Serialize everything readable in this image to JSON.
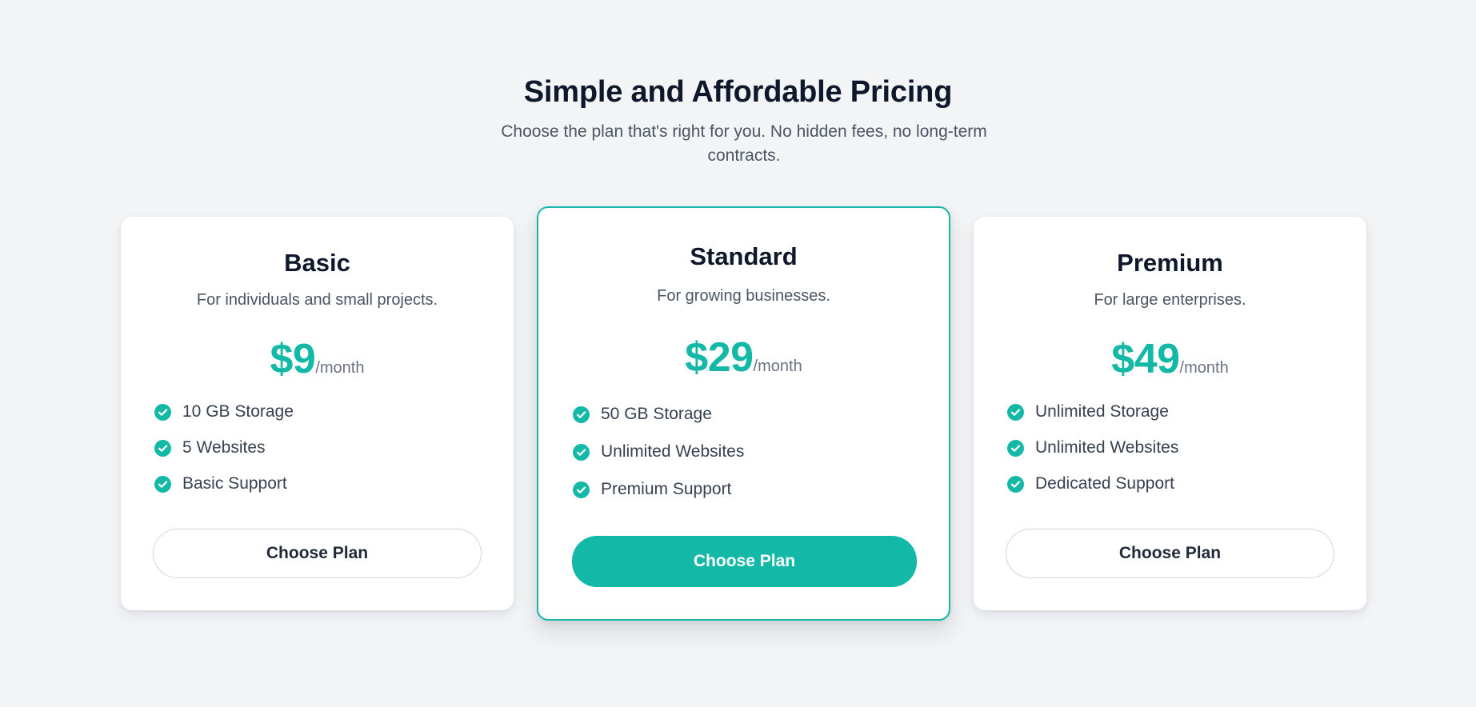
{
  "header": {
    "title": "Simple and Affordable Pricing",
    "subtitle": "Choose the plan that's right for you. No hidden fees, no long-term contracts."
  },
  "plans": [
    {
      "name": "Basic",
      "description": "For individuals and small projects.",
      "price": "$9",
      "period": "/month",
      "features": [
        "10 GB Storage",
        "5 Websites",
        "Basic Support"
      ],
      "button_label": "Choose Plan",
      "featured": false
    },
    {
      "name": "Standard",
      "description": "For growing businesses.",
      "price": "$29",
      "period": "/month",
      "features": [
        "50 GB Storage",
        "Unlimited Websites",
        "Premium Support"
      ],
      "button_label": "Choose Plan",
      "featured": true
    },
    {
      "name": "Premium",
      "description": "For large enterprises.",
      "price": "$49",
      "period": "/month",
      "features": [
        "Unlimited Storage",
        "Unlimited Websites",
        "Dedicated Support"
      ],
      "button_label": "Choose Plan",
      "featured": false
    }
  ],
  "icons": {
    "feature": "check-circle-icon"
  },
  "colors": {
    "accent": "#14b8a6",
    "background": "#f3f4f6",
    "heading": "#0f172a",
    "body_text": "#4b5563"
  }
}
